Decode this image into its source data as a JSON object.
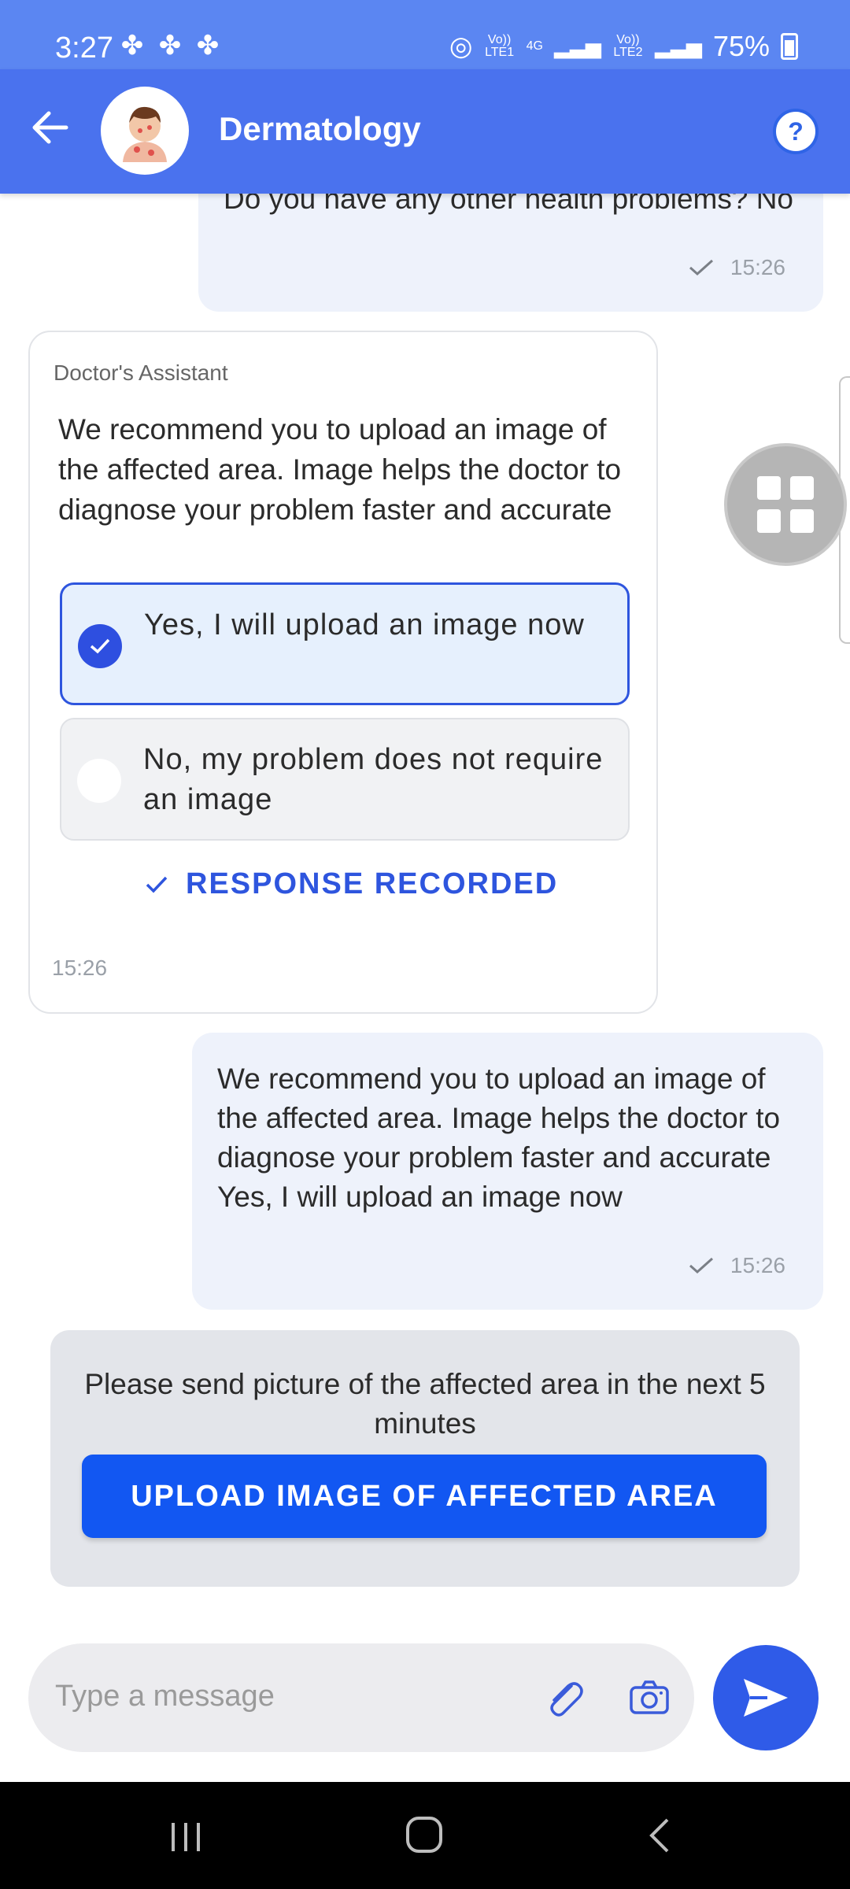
{
  "status_bar": {
    "time": "3:27",
    "battery": "75%",
    "network_sim1": "Vo)) LTE1",
    "network_type": "4G",
    "network_sim2": "Vo)) LTE2"
  },
  "header": {
    "title": "Dermatology",
    "help_label": "?"
  },
  "messages": {
    "prev_sent": {
      "text": "Do you have any other health problems? No",
      "time": "15:26"
    },
    "assistant": {
      "sender": "Doctor's Assistant",
      "text": "We recommend you to upload an image of the affected area. Image helps the doctor to diagnose your problem faster and accurate",
      "options": [
        {
          "label": "Yes, I will upload an image now",
          "selected": true
        },
        {
          "label": "No, my problem does not require an image",
          "selected": false
        }
      ],
      "status": "RESPONSE RECORDED",
      "time": "15:26"
    },
    "reply_sent": {
      "text": "We recommend you to upload an image of the affected area. Image helps the doctor to diagnose your problem faster and accurate Yes, I will upload an image now",
      "time": "15:26"
    }
  },
  "upload_card": {
    "text": "Please send picture of the affected area in the next 5 minutes",
    "button_label": "UPLOAD IMAGE OF AFFECTED AREA"
  },
  "composer": {
    "placeholder": "Type a message"
  },
  "colors": {
    "status_bar": "#5B86F2",
    "header": "#4A72EE",
    "accent": "#2E55DE",
    "upload_button": "#1257F2",
    "outgoing_bubble": "#EEF2FB"
  },
  "icons": [
    "back-arrow-icon",
    "doctor-avatar",
    "help-icon",
    "tick-icon",
    "check-icon",
    "grid-icon",
    "attach-icon",
    "camera-icon",
    "send-icon",
    "recents-icon",
    "home-icon",
    "nav-back-icon"
  ]
}
